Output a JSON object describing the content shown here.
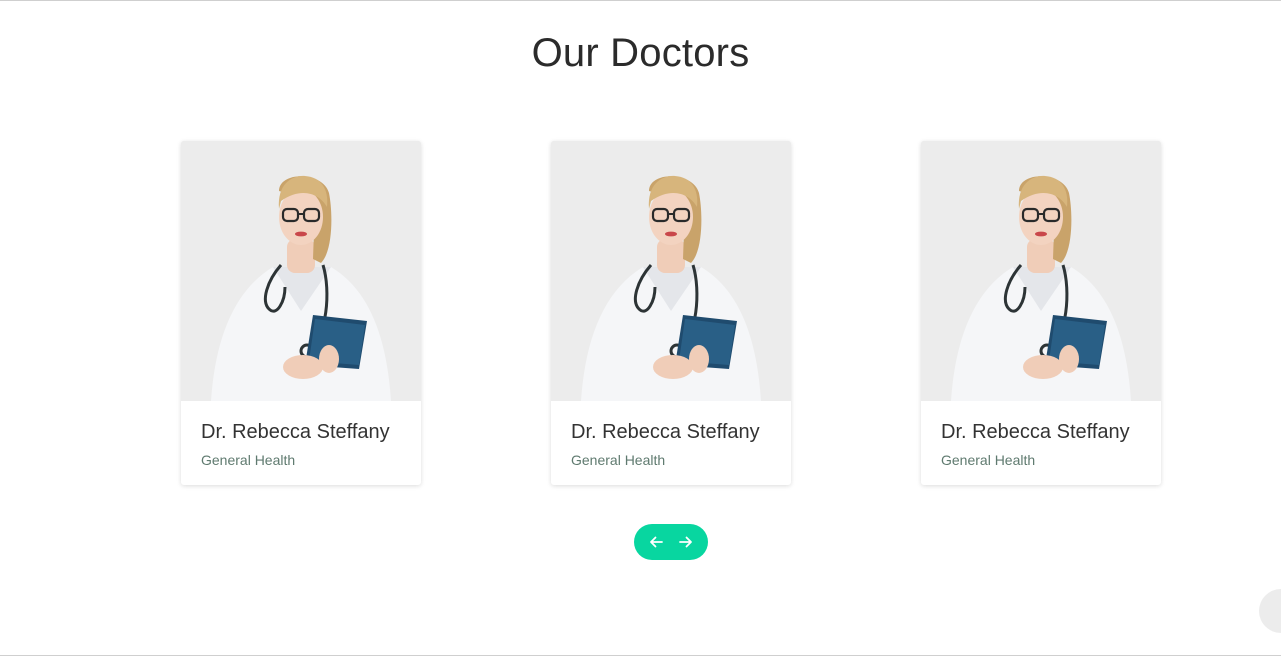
{
  "section": {
    "title": "Our Doctors"
  },
  "doctors": [
    {
      "name": "Dr. Rebecca Steffany",
      "specialty": "General Health"
    },
    {
      "name": "Dr. Rebecca Steffany",
      "specialty": "General Health"
    },
    {
      "name": "Dr. Rebecca Steffany",
      "specialty": "General Health"
    }
  ],
  "carousel": {
    "prev_icon": "arrow-left-icon",
    "next_icon": "arrow-right-icon",
    "accent_color": "#08d6a0"
  },
  "colors": {
    "title": "#2b2b2b",
    "name": "#333333",
    "specialty": "#5f7a6f",
    "accent": "#08d6a0"
  }
}
